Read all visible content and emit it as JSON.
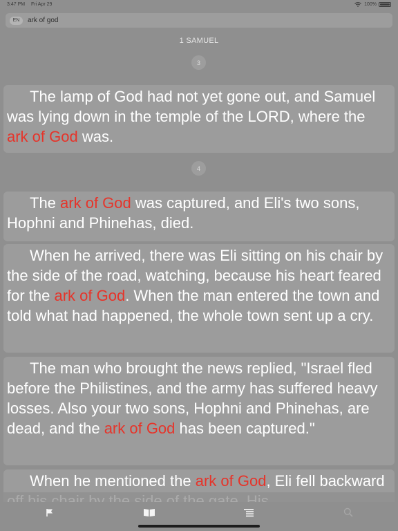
{
  "status_bar": {
    "time": "3:47 PM",
    "date": "Fri Apr 29",
    "battery": "100%",
    "battery_level": 1.0
  },
  "search": {
    "language": "EN",
    "query": "ark of god"
  },
  "book_title": "1 SAMUEL",
  "chapters": [
    {
      "number": "3",
      "verses": [
        {
          "segments": [
            {
              "text": "The lamp of God had not yet gone out, and Samuel was lying down in the temple of the LORD, where the ",
              "hl": false
            },
            {
              "text": "ark of God",
              "hl": true
            },
            {
              "text": " was.",
              "hl": false
            }
          ]
        }
      ]
    },
    {
      "number": "4",
      "verses": [
        {
          "segments": [
            {
              "text": "The ",
              "hl": false
            },
            {
              "text": "ark of God",
              "hl": true
            },
            {
              "text": " was captured, and Eli's two sons, Hophni and Phinehas, died.",
              "hl": false
            }
          ]
        },
        {
          "segments": [
            {
              "text": "When he arrived, there was Eli sitting on his chair by the side of the road, watching, because his heart feared for the ",
              "hl": false
            },
            {
              "text": "ark of God",
              "hl": true
            },
            {
              "text": ". When the man entered the town and told what had happened, the whole town sent up a cry.",
              "hl": false
            }
          ]
        },
        {
          "segments": [
            {
              "text": "The man who brought the news replied, \"Israel fled before the Philistines, and the army has suffered heavy losses. Also your two sons, Hophni and Phinehas, are dead, and the ",
              "hl": false
            },
            {
              "text": "ark of God",
              "hl": true
            },
            {
              "text": " has been captured.\"",
              "hl": false
            }
          ]
        },
        {
          "segments": [
            {
              "text": "When he mentioned the ",
              "hl": false
            },
            {
              "text": "ark of God",
              "hl": true
            },
            {
              "text": ", Eli fell backward off his chair by the side of the gate. His",
              "hl": false
            }
          ]
        }
      ]
    }
  ],
  "tabs": [
    {
      "name": "bookmark",
      "icon": "flag-icon"
    },
    {
      "name": "read",
      "icon": "book-icon"
    },
    {
      "name": "list",
      "icon": "list-icon"
    },
    {
      "name": "search",
      "icon": "search-icon"
    }
  ],
  "colors": {
    "highlight": "#e6342a",
    "text": "#ffffff",
    "card": "#9c9c9c",
    "background": "#8f8f8f"
  }
}
